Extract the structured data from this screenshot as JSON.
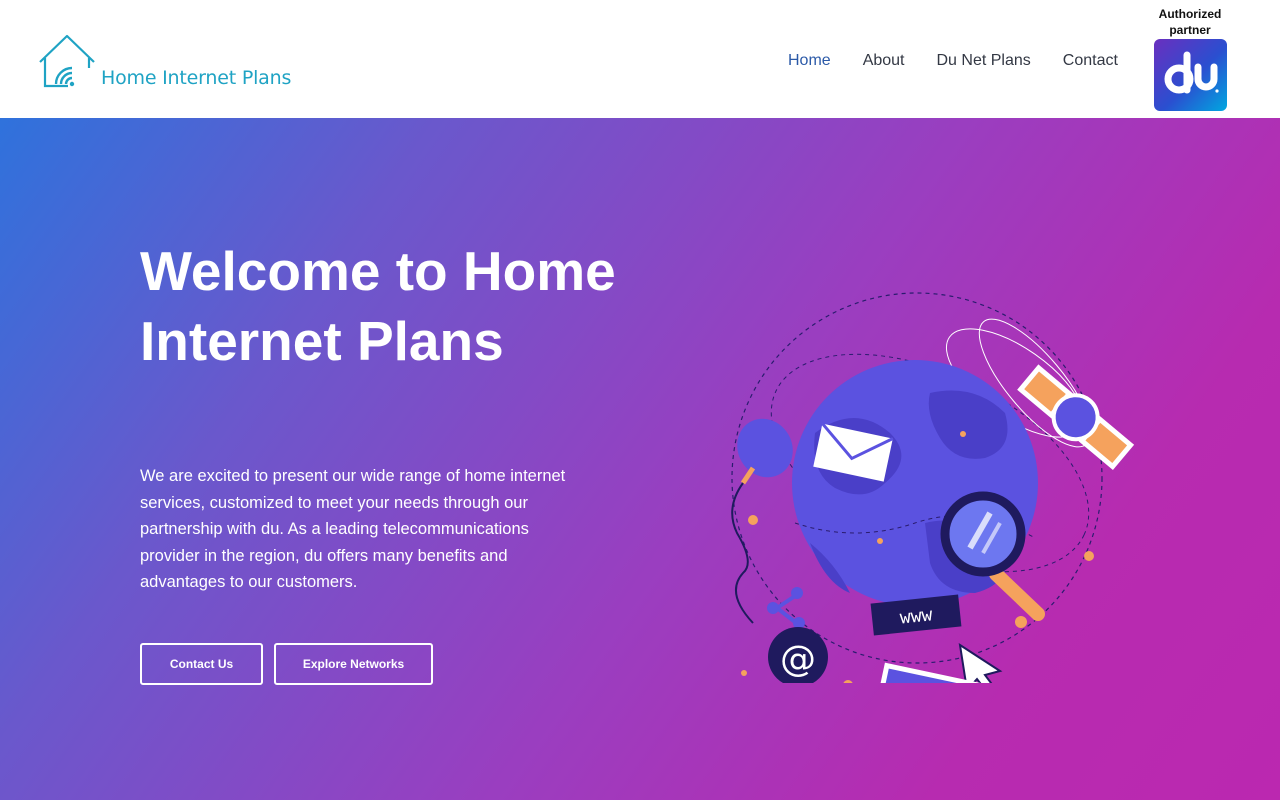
{
  "header": {
    "logo": {
      "text": "Home Internet Plans",
      "icon": "house-wifi-icon",
      "color": "#1fa3c4"
    },
    "nav": [
      {
        "label": "Home",
        "active": true
      },
      {
        "label": "About",
        "active": false
      },
      {
        "label": "Du Net Plans",
        "active": false
      },
      {
        "label": "Contact",
        "active": false
      }
    ],
    "partner": {
      "label": "Authorized partner",
      "logo_text": "du"
    }
  },
  "hero": {
    "title": "Welcome to Home Internet Plans",
    "description": "We are excited to present our wide range of home internet services, customized to meet your needs through our partnership with du. As a leading telecommunications provider in the region, du offers many benefits and advantages to our customers.",
    "buttons": {
      "contact": "Contact Us",
      "explore": "Explore Networks"
    },
    "illustration": {
      "www_label": "www",
      "at_symbol": "@"
    }
  },
  "colors": {
    "hero_gradient_start": "#2f72dc",
    "hero_gradient_end": "#bb28b0",
    "nav_active": "#2c5aa8",
    "nav_text": "#333844",
    "accent_orange": "#f5a25d",
    "globe_purple": "#5b52e0"
  }
}
